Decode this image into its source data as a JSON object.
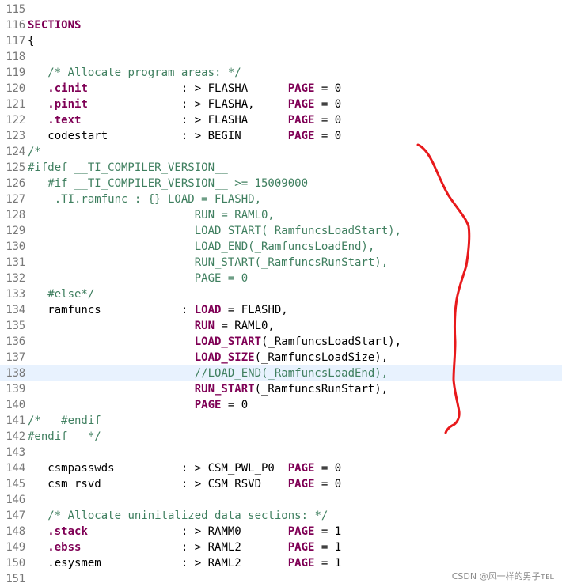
{
  "editor": {
    "lines": [
      {
        "n": "115",
        "segs": []
      },
      {
        "n": "116",
        "segs": [
          [
            "SECTIONS",
            "kw"
          ]
        ]
      },
      {
        "n": "117",
        "segs": [
          [
            "{",
            "normal"
          ]
        ]
      },
      {
        "n": "118",
        "segs": []
      },
      {
        "n": "119",
        "segs": [
          [
            "   ",
            "normal"
          ],
          [
            "/* Allocate program areas: */",
            "comment"
          ]
        ]
      },
      {
        "n": "120",
        "segs": [
          [
            "   ",
            "normal"
          ],
          [
            ".cinit",
            "kw"
          ],
          [
            "              : > FLASHA      ",
            "normal"
          ],
          [
            "PAGE",
            "kw"
          ],
          [
            " = 0",
            "normal"
          ]
        ]
      },
      {
        "n": "121",
        "segs": [
          [
            "   ",
            "normal"
          ],
          [
            ".pinit",
            "kw"
          ],
          [
            "              : > FLASHA,     ",
            "normal"
          ],
          [
            "PAGE",
            "kw"
          ],
          [
            " = 0",
            "normal"
          ]
        ]
      },
      {
        "n": "122",
        "segs": [
          [
            "   ",
            "normal"
          ],
          [
            ".text",
            "kw"
          ],
          [
            "               : > FLASHA      ",
            "normal"
          ],
          [
            "PAGE",
            "kw"
          ],
          [
            " = 0",
            "normal"
          ]
        ]
      },
      {
        "n": "123",
        "segs": [
          [
            "   codestart           : > BEGIN       ",
            "normal"
          ],
          [
            "PAGE",
            "kw"
          ],
          [
            " = 0",
            "normal"
          ]
        ]
      },
      {
        "n": "124",
        "segs": [
          [
            "/*",
            "comment"
          ]
        ]
      },
      {
        "n": "125",
        "segs": [
          [
            "#ifdef __TI_COMPILER_VERSION__",
            "comment"
          ]
        ]
      },
      {
        "n": "126",
        "segs": [
          [
            "   #if __TI_COMPILER_VERSION__ >= 15009000",
            "comment"
          ]
        ]
      },
      {
        "n": "127",
        "segs": [
          [
            "    .TI.ramfunc : {} LOAD = FLASHD,",
            "comment"
          ]
        ]
      },
      {
        "n": "128",
        "segs": [
          [
            "                         RUN = RAML0,",
            "comment"
          ]
        ]
      },
      {
        "n": "129",
        "segs": [
          [
            "                         LOAD_START(_RamfuncsLoadStart),",
            "comment"
          ]
        ]
      },
      {
        "n": "130",
        "segs": [
          [
            "                         LOAD_END(_RamfuncsLoadEnd),",
            "comment"
          ]
        ]
      },
      {
        "n": "131",
        "segs": [
          [
            "                         RUN_START(_RamfuncsRunStart),",
            "comment"
          ]
        ]
      },
      {
        "n": "132",
        "segs": [
          [
            "                         PAGE = 0",
            "comment"
          ]
        ]
      },
      {
        "n": "133",
        "segs": [
          [
            "   #else*/",
            "comment"
          ]
        ]
      },
      {
        "n": "134",
        "segs": [
          [
            "   ramfuncs            : ",
            "normal"
          ],
          [
            "LOAD",
            "kw"
          ],
          [
            " = FLASHD,",
            "normal"
          ]
        ]
      },
      {
        "n": "135",
        "segs": [
          [
            "                         ",
            "normal"
          ],
          [
            "RUN",
            "kw"
          ],
          [
            " = RAML0,",
            "normal"
          ]
        ]
      },
      {
        "n": "136",
        "segs": [
          [
            "                         ",
            "normal"
          ],
          [
            "LOAD_START",
            "kw"
          ],
          [
            "(_RamfuncsLoadStart),",
            "normal"
          ]
        ]
      },
      {
        "n": "137",
        "segs": [
          [
            "                         ",
            "normal"
          ],
          [
            "LOAD_SIZE",
            "kw"
          ],
          [
            "(_RamfuncsLoadSize),",
            "normal"
          ]
        ]
      },
      {
        "n": "138",
        "segs": [
          [
            "                         //LOAD_END(_RamfuncsLoadEnd),",
            "comment"
          ]
        ],
        "current": true
      },
      {
        "n": "139",
        "segs": [
          [
            "                         ",
            "normal"
          ],
          [
            "RUN_START",
            "kw"
          ],
          [
            "(_RamfuncsRunStart),",
            "normal"
          ]
        ]
      },
      {
        "n": "140",
        "segs": [
          [
            "                         ",
            "normal"
          ],
          [
            "PAGE",
            "kw"
          ],
          [
            " = 0",
            "normal"
          ]
        ]
      },
      {
        "n": "141",
        "segs": [
          [
            "/*   #endif",
            "comment"
          ]
        ]
      },
      {
        "n": "142",
        "segs": [
          [
            "#endif   */",
            "comment"
          ]
        ]
      },
      {
        "n": "143",
        "segs": []
      },
      {
        "n": "144",
        "segs": [
          [
            "   csmpasswds          : > CSM_PWL_P0  ",
            "normal"
          ],
          [
            "PAGE",
            "kw"
          ],
          [
            " = 0",
            "normal"
          ]
        ]
      },
      {
        "n": "145",
        "segs": [
          [
            "   csm_rsvd            : > CSM_RSVD    ",
            "normal"
          ],
          [
            "PAGE",
            "kw"
          ],
          [
            " = 0",
            "normal"
          ]
        ]
      },
      {
        "n": "146",
        "segs": []
      },
      {
        "n": "147",
        "segs": [
          [
            "   ",
            "normal"
          ],
          [
            "/* Allocate uninitalized data sections: */",
            "comment"
          ]
        ]
      },
      {
        "n": "148",
        "segs": [
          [
            "   ",
            "normal"
          ],
          [
            ".stack",
            "kw"
          ],
          [
            "              : > RAMM0       ",
            "normal"
          ],
          [
            "PAGE",
            "kw"
          ],
          [
            " = 1",
            "normal"
          ]
        ]
      },
      {
        "n": "149",
        "segs": [
          [
            "   ",
            "normal"
          ],
          [
            ".ebss",
            "kw"
          ],
          [
            "               : > RAML2       ",
            "normal"
          ],
          [
            "PAGE",
            "kw"
          ],
          [
            " = 1",
            "normal"
          ]
        ]
      },
      {
        "n": "150",
        "segs": [
          [
            "   .esysmem            : > RAML2       ",
            "normal"
          ],
          [
            "PAGE",
            "kw"
          ],
          [
            " = 1",
            "normal"
          ]
        ]
      },
      {
        "n": "151",
        "segs": []
      }
    ]
  },
  "colors": {
    "keyword": "#7f0055",
    "comment": "#3f7f5f",
    "line_number": "#787878",
    "current_line": "#e8f2fe",
    "annotation": "#e8191b"
  },
  "watermark": {
    "text": "CSDN @风一样的男子ᴛᴇʟ"
  }
}
